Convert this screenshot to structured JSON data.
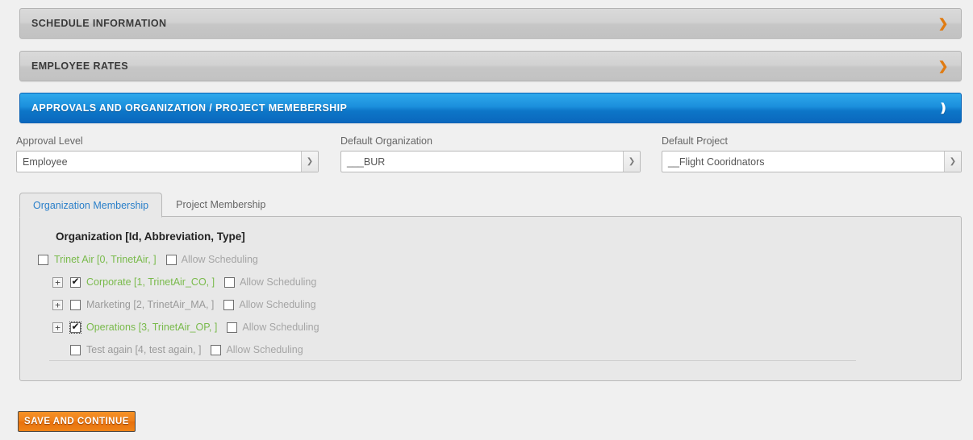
{
  "sections": [
    {
      "title": "Schedule Information",
      "expanded": false,
      "chevron": "chevron-right-icon"
    },
    {
      "title": "Employee Rates",
      "expanded": false,
      "chevron": "chevron-right-icon"
    },
    {
      "title": "Approvals and Organization / Project Memebership",
      "expanded": true,
      "chevron": "chevron-down-icon"
    }
  ],
  "form": {
    "approval_level": {
      "label": "Approval Level",
      "value": "Employee"
    },
    "default_organization": {
      "label": "Default Organization",
      "value": "___BUR"
    },
    "default_project": {
      "label": "Default Project",
      "value": "__Flight Cooridnators"
    }
  },
  "tabs": [
    {
      "label": "Organization Membership",
      "active": true
    },
    {
      "label": "Project Membership",
      "active": false
    }
  ],
  "tree": {
    "header": "Organization [Id, Abbreviation, Type]",
    "allow_scheduling_label": "Allow Scheduling",
    "rows": [
      {
        "name": "Trinet Air [0, TrinetAir, ]",
        "level": 0,
        "expander": false,
        "checked": false,
        "active": true,
        "allow_scheduling": false
      },
      {
        "name": "Corporate [1, TrinetAir_CO, ]",
        "level": 1,
        "expander": true,
        "checked": true,
        "active": true,
        "allow_scheduling": false
      },
      {
        "name": "Marketing [2, TrinetAir_MA, ]",
        "level": 1,
        "expander": true,
        "checked": false,
        "active": false,
        "allow_scheduling": false
      },
      {
        "name": "Operations [3, TrinetAir_OP, ]",
        "level": 1,
        "expander": true,
        "checked": true,
        "active": true,
        "allow_scheduling": false,
        "focused": true
      },
      {
        "name": "Test again [4, test again, ]",
        "level": 1,
        "expander": false,
        "checked": false,
        "active": false,
        "allow_scheduling": false
      }
    ]
  },
  "actions": {
    "save_label": "Save and Continue"
  },
  "colors": {
    "accent_blue": "#1b8fdc",
    "active_green": "#79ba4b",
    "inactive_grey": "#9a9a9a",
    "save_orange": "#ef7e17",
    "chevron_orange": "#e07b12"
  }
}
